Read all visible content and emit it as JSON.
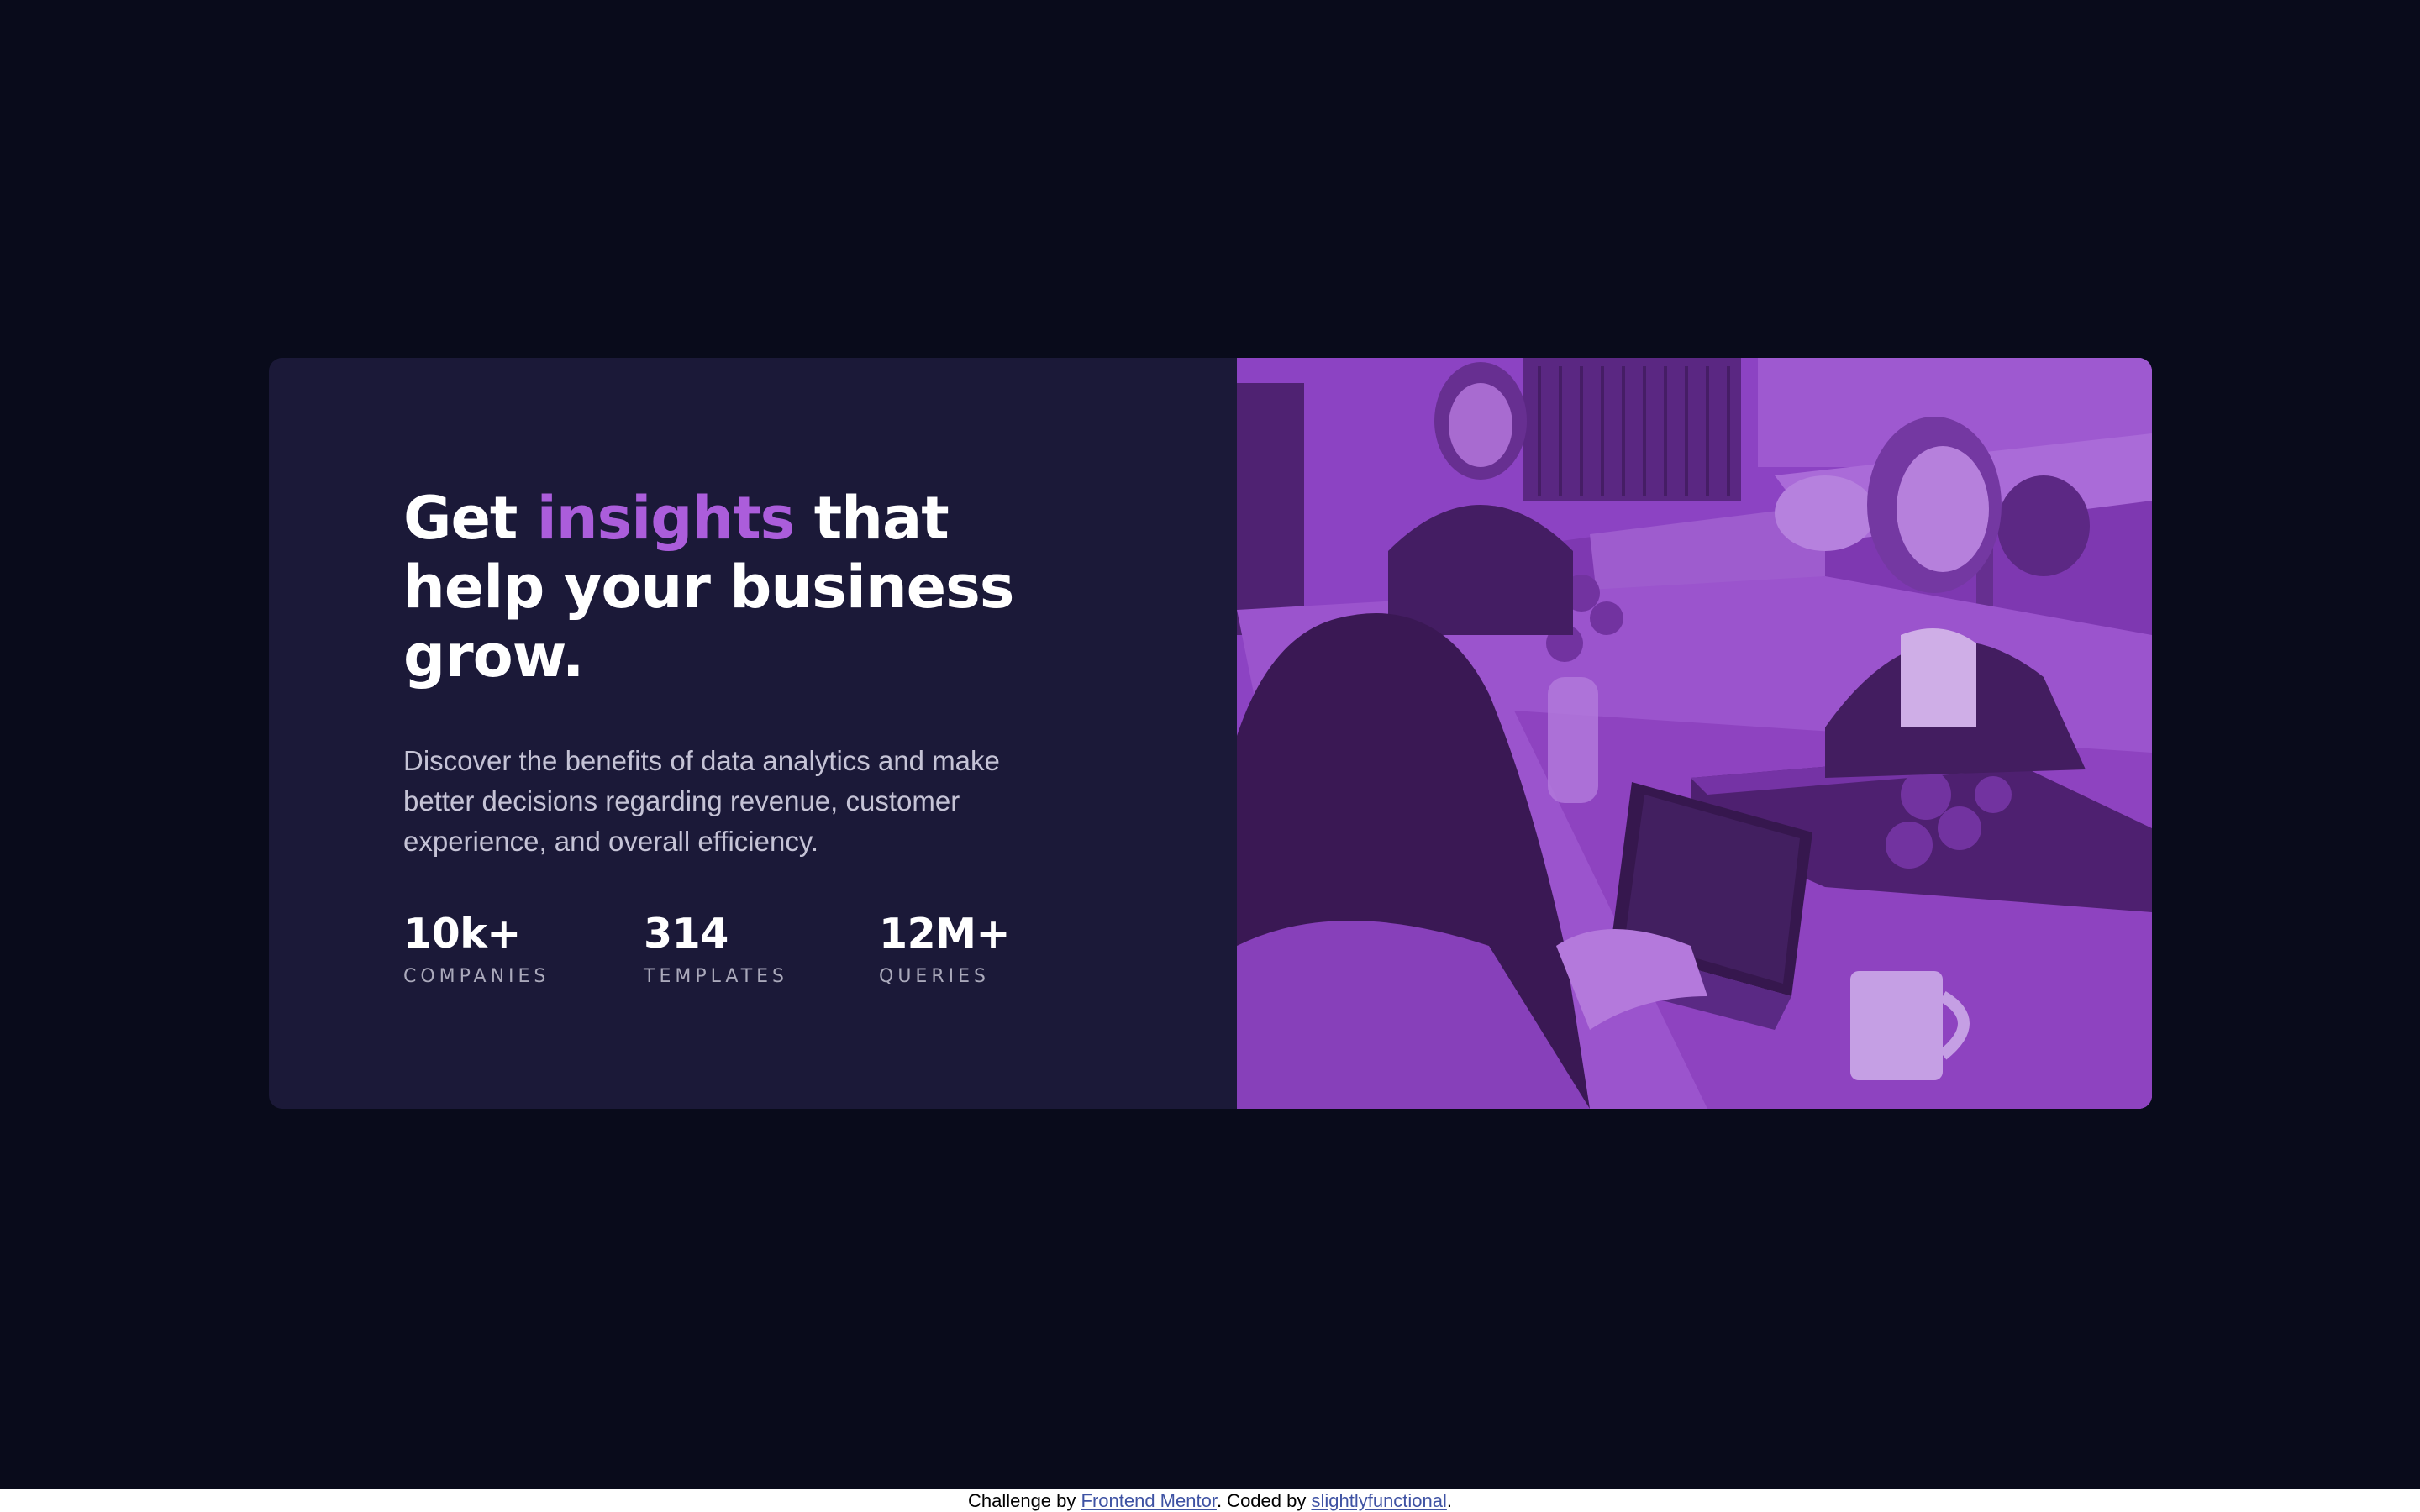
{
  "hero": {
    "headline_prefix": "Get ",
    "headline_accent": "insights",
    "headline_suffix": " that help your business grow.",
    "description": "Discover the benefits of data analytics and make better decisions regarding revenue, customer experience, and overall efficiency."
  },
  "stats": [
    {
      "value": "10k+",
      "label": "COMPANIES"
    },
    {
      "value": "314",
      "label": "TEMPLATES"
    },
    {
      "value": "12M+",
      "label": "QUERIES"
    }
  ],
  "footer": {
    "prefix": "Challenge by ",
    "link1": "Frontend Mentor",
    "middle": ". Coded by ",
    "link2": "slightlyfunctional",
    "suffix": "."
  },
  "colors": {
    "page_bg": "#090b1b",
    "card_bg": "#1b1938",
    "accent": "#ab5ddb",
    "photo_tint": "#8a3fc0"
  }
}
